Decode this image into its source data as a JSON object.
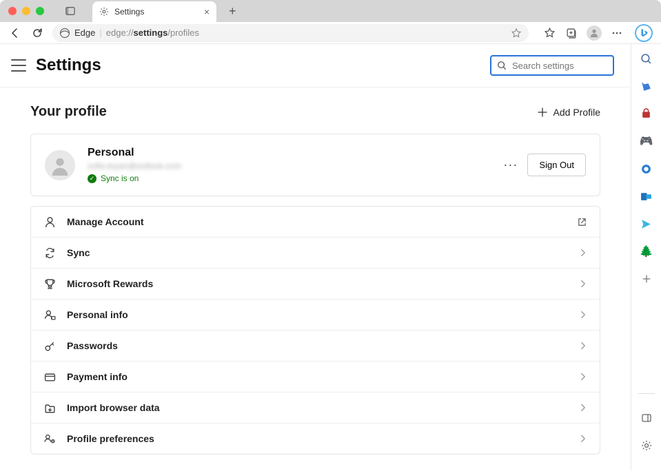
{
  "window": {
    "tab_title": "Settings"
  },
  "toolbar": {
    "brand": "Edge",
    "url_prefix": "edge://",
    "url_bold": "settings",
    "url_suffix": "/profiles"
  },
  "header": {
    "title": "Settings",
    "search_placeholder": "Search settings"
  },
  "section": {
    "title": "Your profile",
    "add_profile": "Add Profile"
  },
  "profile": {
    "name": "Personal",
    "email": "sofia.bryan@outlook.com",
    "sync_status": "Sync is on",
    "more": "···",
    "sign_out": "Sign Out"
  },
  "rows": [
    {
      "icon": "user",
      "label": "Manage Account",
      "action": "external"
    },
    {
      "icon": "sync",
      "label": "Sync",
      "action": "chevron"
    },
    {
      "icon": "trophy",
      "label": "Microsoft Rewards",
      "action": "chevron"
    },
    {
      "icon": "personal",
      "label": "Personal info",
      "action": "chevron"
    },
    {
      "icon": "key",
      "label": "Passwords",
      "action": "chevron"
    },
    {
      "icon": "card",
      "label": "Payment info",
      "action": "chevron"
    },
    {
      "icon": "import",
      "label": "Import browser data",
      "action": "chevron"
    },
    {
      "icon": "prefs",
      "label": "Profile preferences",
      "action": "chevron"
    }
  ]
}
